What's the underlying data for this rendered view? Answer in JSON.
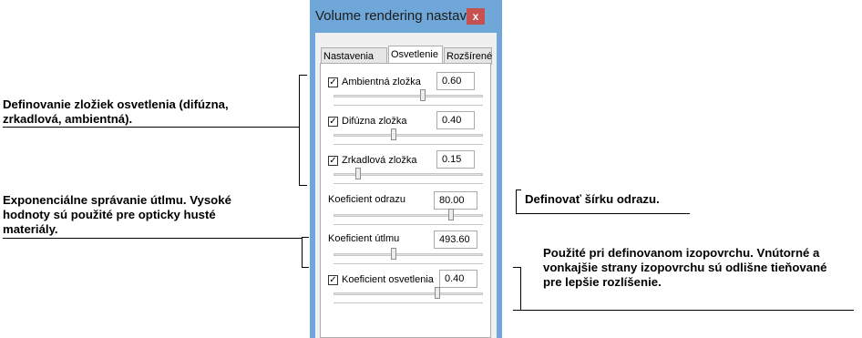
{
  "window": {
    "title": "Volume rendering nastav...",
    "close_glyph": "x"
  },
  "tabs": [
    {
      "label": "Nastavenia",
      "active": false
    },
    {
      "label": "Osvetlenie",
      "active": true
    },
    {
      "label": "Rozšírené",
      "active": false
    }
  ],
  "controls": [
    {
      "label": "Ambientná zložka",
      "checked": true,
      "value": "0.60",
      "slider_fraction": 0.6
    },
    {
      "label": "Difúzna zložka",
      "checked": true,
      "value": "0.40",
      "slider_fraction": 0.4
    },
    {
      "label": "Zrkadlová zložka",
      "checked": true,
      "value": "0.15",
      "slider_fraction": 0.15
    },
    {
      "label": "Koeficient odrazu",
      "checked": null,
      "value": "80.00",
      "slider_fraction": 0.8
    },
    {
      "label": "Koeficient útlmu",
      "checked": null,
      "value": "493.60",
      "slider_fraction": 0.4
    },
    {
      "label": "Koeficient osvetlenia",
      "checked": true,
      "value": "0.40",
      "slider_fraction": 0.7
    }
  ],
  "annotations": {
    "left_top": [
      "Definovanie zložiek osvetlenia (difúzna,",
      "zrkadlová, ambientná)."
    ],
    "left_bottom": [
      "Exponenciálne správanie útlmu. Vysoké",
      "hodnoty sú použité pre opticky husté",
      "materiály."
    ],
    "right_top": [
      "Definovať šírku odrazu."
    ],
    "right_bottom": [
      "Použité pri definovanom izopovrchu. Vnútorné a",
      "vonkajšie strany izopovrchu sú odlišne tieňované",
      "pre lepšie rozlíšenie."
    ]
  },
  "colors": {
    "window_frame": "#6fa8d8",
    "close_button": "#c75050"
  }
}
